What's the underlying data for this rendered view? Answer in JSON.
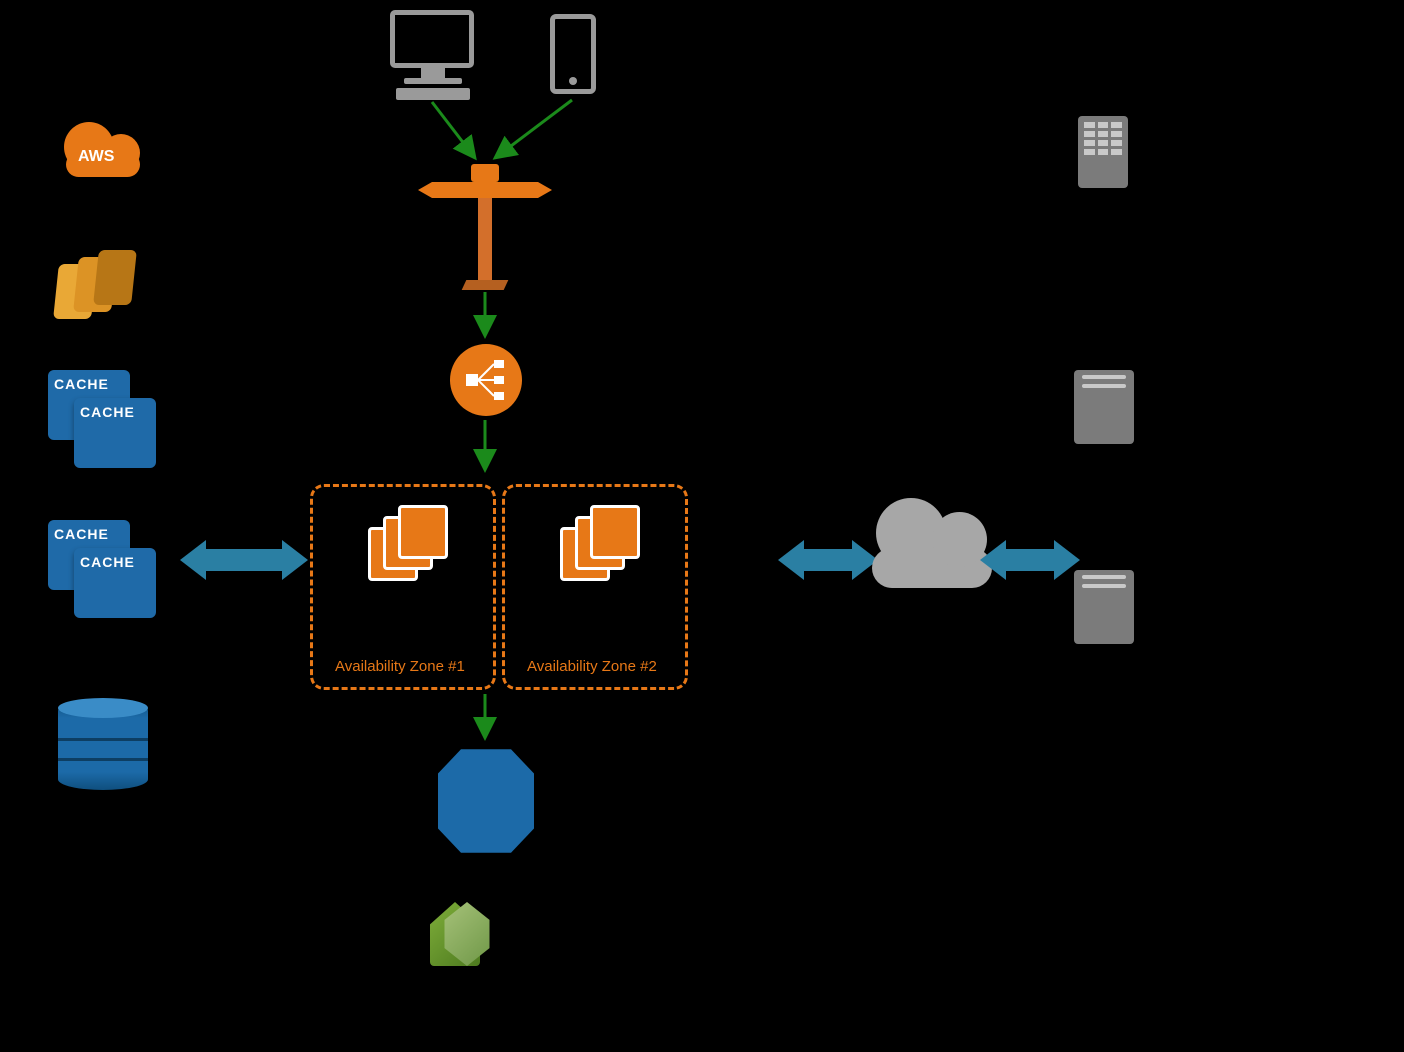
{
  "colors": {
    "orange": "#e77817",
    "green": "#1b8a1b",
    "blue": "#1c6aa8",
    "grey": "#9a9a9a",
    "teal": "#2a7fa3"
  },
  "icons": {
    "aws_cloud": {
      "text": "AWS",
      "label": "Amazon Web Services"
    },
    "cloudfront": {
      "label": "CloudFront"
    },
    "elasticache_1": {
      "text": "CACHE",
      "label": "ElastiCache cluster 1"
    },
    "elasticache_2": {
      "text": "CACHE",
      "label": "ElastiCache cluster 2"
    },
    "rds_left": {
      "label": "RDS / Database"
    },
    "desktop": {
      "label": "Desktop client"
    },
    "mobile": {
      "label": "Mobile client"
    },
    "route53": {
      "label": "Route 53"
    },
    "elb": {
      "label": "Elastic Load Balancer"
    },
    "simpledb": {
      "label": "SimpleDB / DynamoDB"
    },
    "cloudwatch_1": {
      "label": "CloudWatch"
    },
    "cloudwatch_2": {
      "label": "Auto Scaling"
    },
    "internet_cloud": {
      "label": "Internet"
    },
    "office": {
      "label": "Corporate office"
    },
    "server_1": {
      "label": "On-prem server 1"
    },
    "server_2": {
      "label": "On-prem server 2"
    }
  },
  "availability_zones": {
    "az1": {
      "label": "Availability Zone #1"
    },
    "az2": {
      "label": "Availability Zone #2"
    }
  },
  "arrows": {
    "desktop_to_r53": {
      "from": "desktop",
      "to": "route53"
    },
    "mobile_to_r53": {
      "from": "mobile",
      "to": "route53"
    },
    "r53_to_elb": {
      "from": "route53",
      "to": "elb"
    },
    "elb_to_az": {
      "from": "elb",
      "to": "availability-zones"
    },
    "az_to_db": {
      "from": "availability-zones",
      "to": "simpledb"
    },
    "left_biarrow": {
      "from": "elasticache",
      "to": "availability-zones"
    },
    "right_biarrow_1": {
      "from": "availability-zones",
      "to": "internet"
    },
    "right_biarrow_2": {
      "from": "internet",
      "to": "on-prem"
    }
  }
}
